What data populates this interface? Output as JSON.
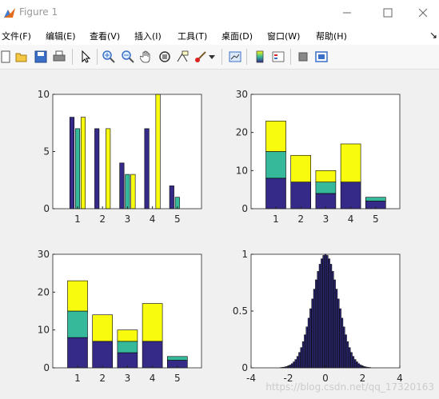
{
  "window": {
    "title": "Figure 1",
    "minimize_icon": "minimize-icon",
    "maximize_icon": "maximize-icon",
    "close_icon": "close-icon"
  },
  "menu": {
    "items": [
      "文件(F)",
      "编辑(E)",
      "查看(V)",
      "插入(I)",
      "工具(T)",
      "桌面(D)",
      "窗口(W)",
      "帮助(H)"
    ],
    "overflow_icon": "chevron-icon"
  },
  "toolbar": {
    "icons": [
      "new-figure-icon",
      "open-file-icon",
      "save-icon",
      "print-icon",
      "pointer-icon",
      "zoom-in-icon",
      "zoom-out-icon",
      "pan-hand-icon",
      "rotate-3d-icon",
      "data-cursor-icon",
      "brush-icon",
      "brush-dropdown-icon",
      "link-plot-icon",
      "colorbar-icon",
      "legend-icon",
      "hide-plot-tools-icon",
      "show-plot-tools-icon"
    ]
  },
  "colors": {
    "series1": "#352a87",
    "series2": "#36b89a",
    "series3": "#f9fb0e",
    "hist": "#2c2875"
  },
  "chart_data": [
    {
      "type": "bar",
      "layout": "grouped",
      "categories": [
        "1",
        "2",
        "3",
        "4",
        "5"
      ],
      "series": [
        {
          "values": [
            8,
            7,
            4,
            7,
            2
          ]
        },
        {
          "values": [
            7,
            0,
            3,
            0,
            1
          ]
        },
        {
          "values": [
            8,
            7,
            3,
            10,
            0
          ]
        }
      ],
      "ylim": [
        0,
        10
      ],
      "yticks": [
        "0",
        "5",
        "10"
      ]
    },
    {
      "type": "bar",
      "layout": "stacked",
      "categories": [
        "1",
        "2",
        "3",
        "4",
        "5"
      ],
      "series": [
        {
          "values": [
            8,
            7,
            4,
            7,
            2
          ]
        },
        {
          "values": [
            7,
            0,
            3,
            0,
            1
          ]
        },
        {
          "values": [
            8,
            7,
            3,
            10,
            0
          ]
        }
      ],
      "ylim": [
        0,
        30
      ],
      "yticks": [
        "0",
        "10",
        "20",
        "30"
      ]
    },
    {
      "type": "bar",
      "layout": "stacked",
      "categories": [
        "1",
        "2",
        "3",
        "4",
        "5"
      ],
      "series": [
        {
          "values": [
            8,
            7,
            4,
            7,
            2
          ]
        },
        {
          "values": [
            7,
            0,
            3,
            0,
            1
          ]
        },
        {
          "values": [
            8,
            7,
            3,
            10,
            0
          ]
        }
      ],
      "ylim": [
        0,
        30
      ],
      "yticks": [
        "0",
        "10",
        "20",
        "30"
      ]
    },
    {
      "type": "bar",
      "layout": "histogram",
      "x_range": [
        -2.4,
        2.4
      ],
      "bin_width": 0.1,
      "shape": "gaussian",
      "peak": 1,
      "sigma": 0.7,
      "xlim": [
        -4,
        4
      ],
      "ylim": [
        0,
        1
      ],
      "xticks": [
        "-4",
        "-2",
        "0",
        "2",
        "4"
      ],
      "yticks": [
        "0",
        "0.5",
        "1"
      ]
    }
  ],
  "watermark": "https://blog.csdn.net/qq_17320163"
}
